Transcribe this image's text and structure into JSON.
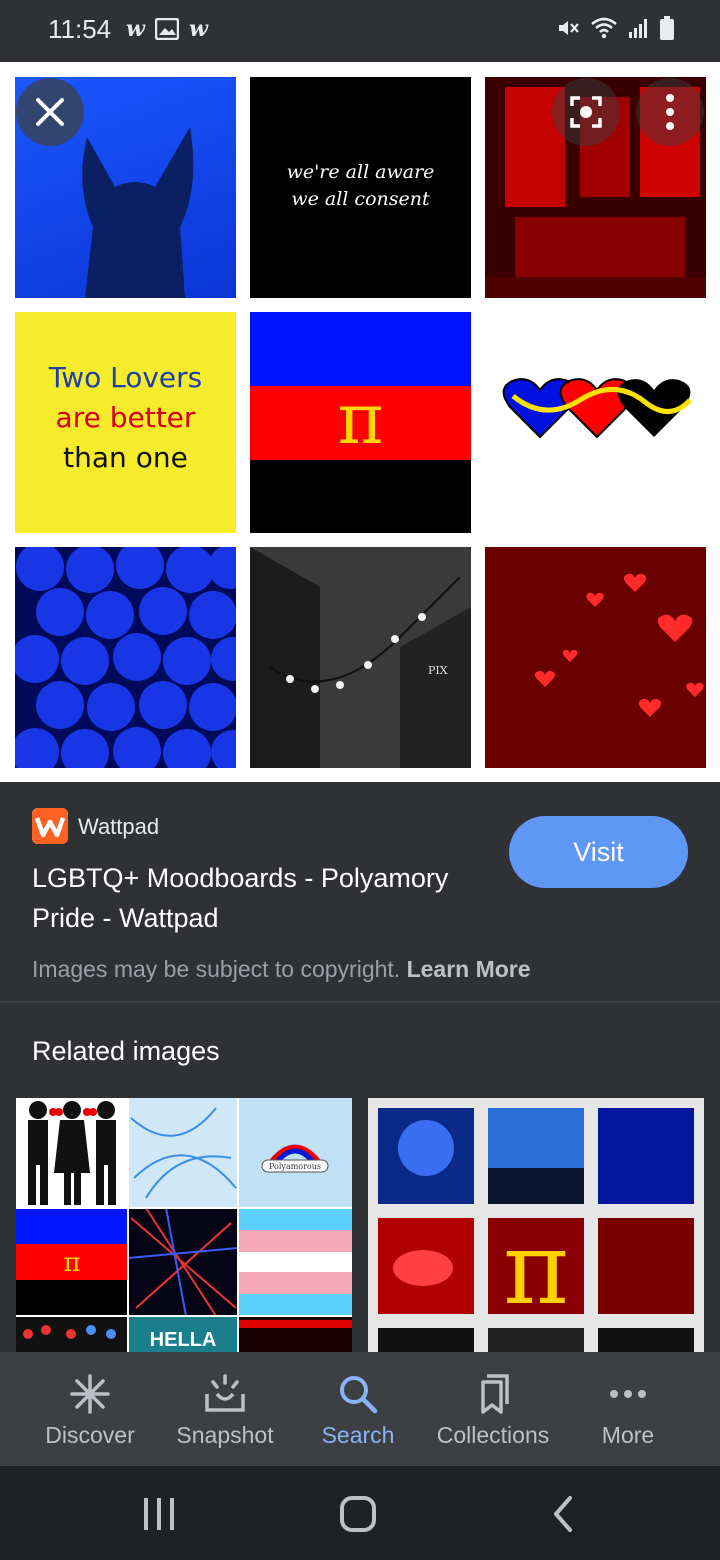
{
  "status_bar": {
    "time": "11:54",
    "notif_icons": [
      "w",
      "image-icon",
      "w"
    ]
  },
  "viewer": {
    "tiles": [
      "blue-fox-silhouette",
      "we're all aware we all consent",
      "red-room",
      "two-lovers-text",
      "polyamory-flag",
      "three-hearts",
      "blue-balls",
      "string-lights-street",
      "red-hearts-wall"
    ],
    "tile_texts": {
      "consent_line1": "we're all aware",
      "consent_line2": "we all consent",
      "lovers_line1": "Two Lovers",
      "lovers_line2": "are better",
      "lovers_line3": "than one",
      "pi": "π",
      "pix": "PIX"
    }
  },
  "result": {
    "source": "Wattpad",
    "title": "LGBTQ+ Moodboards - Polyamory Pride - Wattpad",
    "visit_label": "Visit",
    "copyright": "Images may be subject to copyright.",
    "learn_more": "Learn More"
  },
  "related": {
    "heading": "Related images",
    "left_texts": {
      "badge": "Polyamorous",
      "pi": "π",
      "hella": "HELLA"
    },
    "right_texts": {
      "pi": "π"
    }
  },
  "bottom_nav": [
    {
      "label": "Discover",
      "icon": "asterisk-icon"
    },
    {
      "label": "Snapshot",
      "icon": "snapshot-icon"
    },
    {
      "label": "Search",
      "icon": "search-icon",
      "active": true
    },
    {
      "label": "Collections",
      "icon": "collections-icon"
    },
    {
      "label": "More",
      "icon": "more-dots-icon"
    }
  ],
  "colors": {
    "accent": "#8ab4f8",
    "visit_button": "#5e97f6",
    "background": "#303134",
    "nav_bg": "#3c4043"
  }
}
